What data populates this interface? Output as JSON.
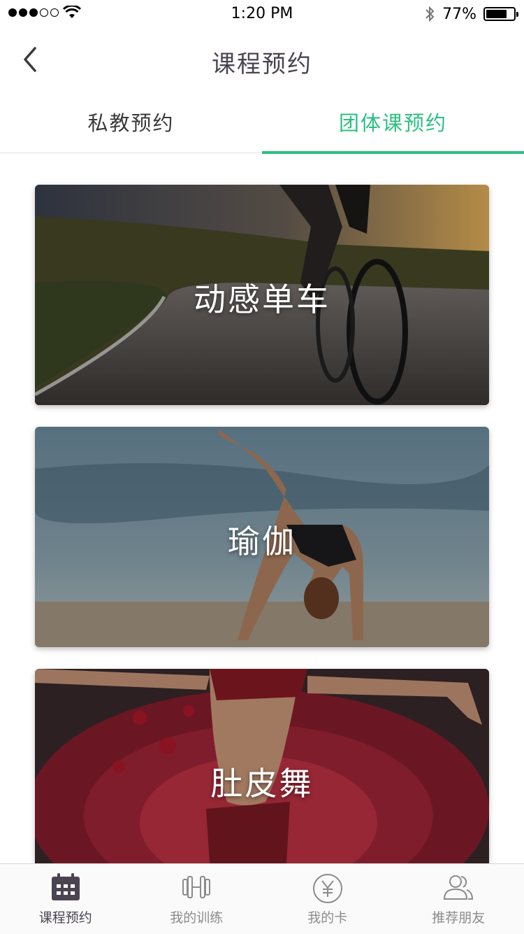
{
  "status": {
    "time": "1:20 PM",
    "battery_percent_label": "77%",
    "battery_level": 0.77,
    "signal_bars_filled": 3,
    "signal_bars_total": 5
  },
  "nav": {
    "title": "课程预约",
    "back_icon": "chevron-left-icon"
  },
  "tabs": [
    {
      "label": "私教预约",
      "active": false
    },
    {
      "label": "团体课预约",
      "active": true
    }
  ],
  "courses": [
    {
      "label": "动感单车"
    },
    {
      "label": "瑜伽"
    },
    {
      "label": "肚皮舞"
    }
  ],
  "tabbar": [
    {
      "label": "课程预约",
      "icon": "calendar-icon",
      "active": true
    },
    {
      "label": "我的训练",
      "icon": "dumbbell-icon",
      "active": false
    },
    {
      "label": "我的卡",
      "icon": "yen-circle-icon",
      "active": false
    },
    {
      "label": "推荐朋友",
      "icon": "friends-icon",
      "active": false
    }
  ],
  "colors": {
    "accent": "#2dbf83",
    "title": "#4a4452",
    "tab_inactive_text": "#8b8b8b"
  }
}
